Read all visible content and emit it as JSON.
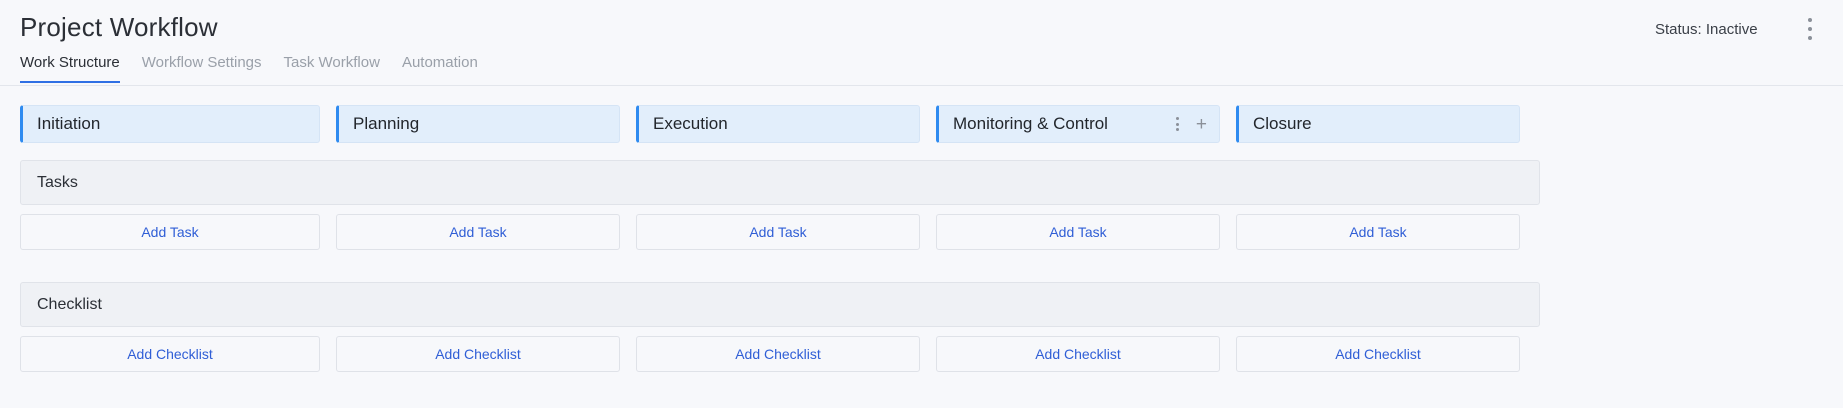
{
  "header": {
    "title": "Project Workflow",
    "status": "Status: Inactive"
  },
  "tabs": [
    {
      "label": "Work Structure",
      "active": true
    },
    {
      "label": "Workflow Settings",
      "active": false
    },
    {
      "label": "Task Workflow",
      "active": false
    },
    {
      "label": "Automation",
      "active": false
    }
  ],
  "phases": [
    {
      "label": "Initiation"
    },
    {
      "label": "Planning"
    },
    {
      "label": "Execution"
    },
    {
      "label": "Monitoring & Control"
    },
    {
      "label": "Closure"
    }
  ],
  "sections": {
    "tasks": {
      "label": "Tasks",
      "add_label": "Add Task"
    },
    "checklist": {
      "label": "Checklist",
      "add_label": "Add Checklist"
    }
  },
  "colors": {
    "accent": "#2f8bf0",
    "link": "#2f5ed6",
    "phase_bg": "#e2eefb"
  }
}
